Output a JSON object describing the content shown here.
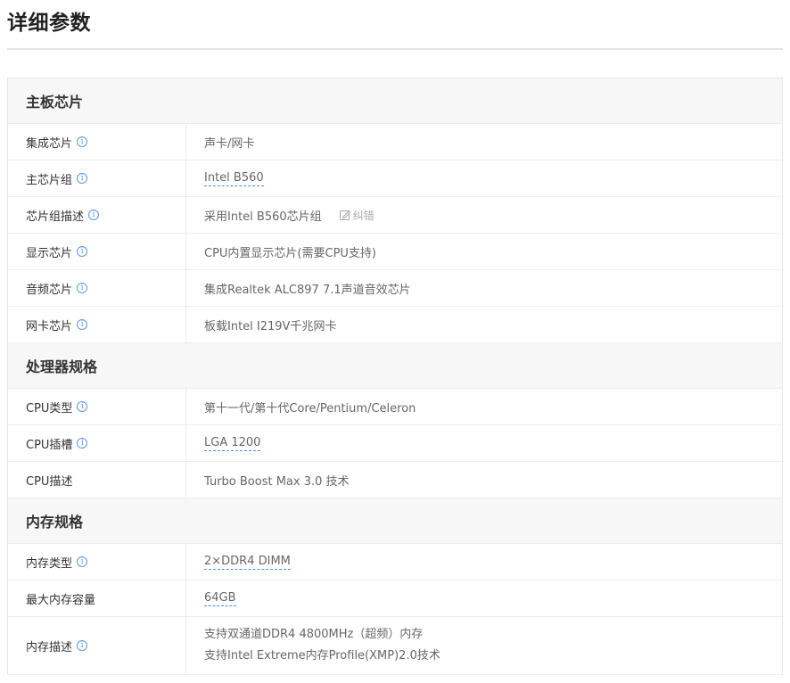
{
  "page": {
    "title": "详细参数"
  },
  "sections": [
    {
      "title": "主板芯片",
      "rows": [
        {
          "label": "集成芯片",
          "info": true,
          "value": "声卡/网卡",
          "link": false
        },
        {
          "label": "主芯片组",
          "info": true,
          "value": "Intel B560",
          "link": true
        },
        {
          "label": "芯片组描述",
          "info": true,
          "value": "采用Intel B560芯片组",
          "link": false,
          "correct_label": "纠错"
        },
        {
          "label": "显示芯片",
          "info": true,
          "value": "CPU内置显示芯片(需要CPU支持)",
          "link": false
        },
        {
          "label": "音频芯片",
          "info": true,
          "value": "集成Realtek ALC897 7.1声道音效芯片",
          "link": false
        },
        {
          "label": "网卡芯片",
          "info": true,
          "value": "板载Intel I219V千兆网卡",
          "link": false
        }
      ]
    },
    {
      "title": "处理器规格",
      "rows": [
        {
          "label": "CPU类型",
          "info": true,
          "value": "第十一代/第十代Core/Pentium/Celeron",
          "link": false
        },
        {
          "label": "CPU插槽",
          "info": true,
          "value": "LGA 1200",
          "link": true
        },
        {
          "label": "CPU描述",
          "info": false,
          "value": "Turbo Boost Max 3.0 技术",
          "link": false
        }
      ]
    },
    {
      "title": "内存规格",
      "rows": [
        {
          "label": "内存类型",
          "info": true,
          "value": "2×DDR4 DIMM",
          "link": true
        },
        {
          "label": "最大内存容量",
          "info": false,
          "value": "64GB",
          "link": true
        },
        {
          "label": "内存描述",
          "info": true,
          "values": [
            "支持双通道DDR4 4800MHz（超频）内存",
            "支持Intel Extreme内存Profile(XMP)2.0技术"
          ],
          "link": false
        }
      ]
    }
  ],
  "icons": {
    "info_glyph": "i"
  },
  "colors": {
    "info_blue": "#5a9ae0",
    "link_underline": "#4a8fd8",
    "section_bg": "#f7f7f7"
  }
}
